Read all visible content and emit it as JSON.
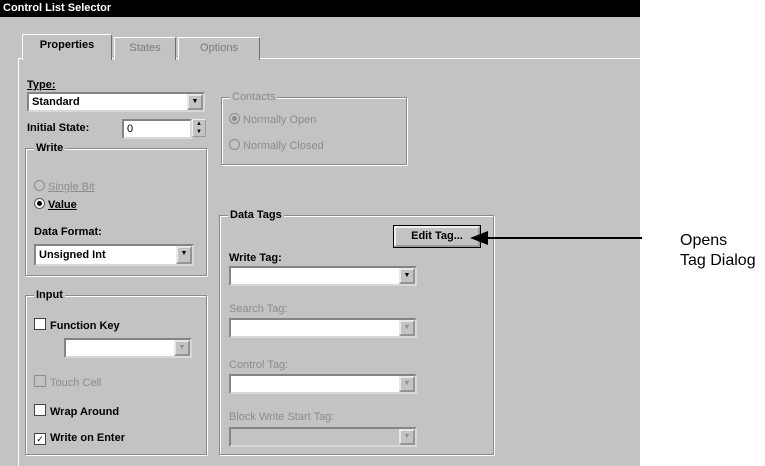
{
  "window": {
    "title": "Control List Selector"
  },
  "tabs": [
    {
      "label": "Properties",
      "active": true
    },
    {
      "label": "States",
      "active": false
    },
    {
      "label": "Options",
      "active": false
    }
  ],
  "type": {
    "label": "Type:",
    "value": "Standard"
  },
  "initial_state": {
    "label": "Initial State:",
    "value": "0"
  },
  "write_group": {
    "title": "Write",
    "single_bit_label": "Single Bit",
    "value_label": "Value",
    "selected": "Value",
    "data_format_label": "Data Format:",
    "data_format_value": "Unsigned Int"
  },
  "contacts_group": {
    "title": "Contacts",
    "normally_open_label": "Normally Open",
    "normally_closed_label": "Normally Closed",
    "selected": "Normally Open"
  },
  "input_group": {
    "title": "Input",
    "function_key_label": "Function Key",
    "function_key_checked": false,
    "function_key_value": "",
    "touch_cell_label": "Touch Cell",
    "touch_cell_checked": false,
    "wrap_around_label": "Wrap Around",
    "wrap_around_checked": false,
    "write_on_enter_label": "Write on Enter",
    "write_on_enter_checked": true
  },
  "data_tags_group": {
    "title": "Data Tags",
    "edit_tag_button": "Edit Tag...",
    "write_tag_label": "Write Tag:",
    "write_tag_value": "",
    "search_tag_label": "Search Tag:",
    "search_tag_value": "",
    "control_tag_label": "Control Tag:",
    "control_tag_value": "",
    "block_write_start_tag_label": "Block Write Start Tag:",
    "block_write_start_tag_value": ""
  },
  "callout": {
    "line1": "Opens",
    "line2": "Tag Dialog"
  }
}
